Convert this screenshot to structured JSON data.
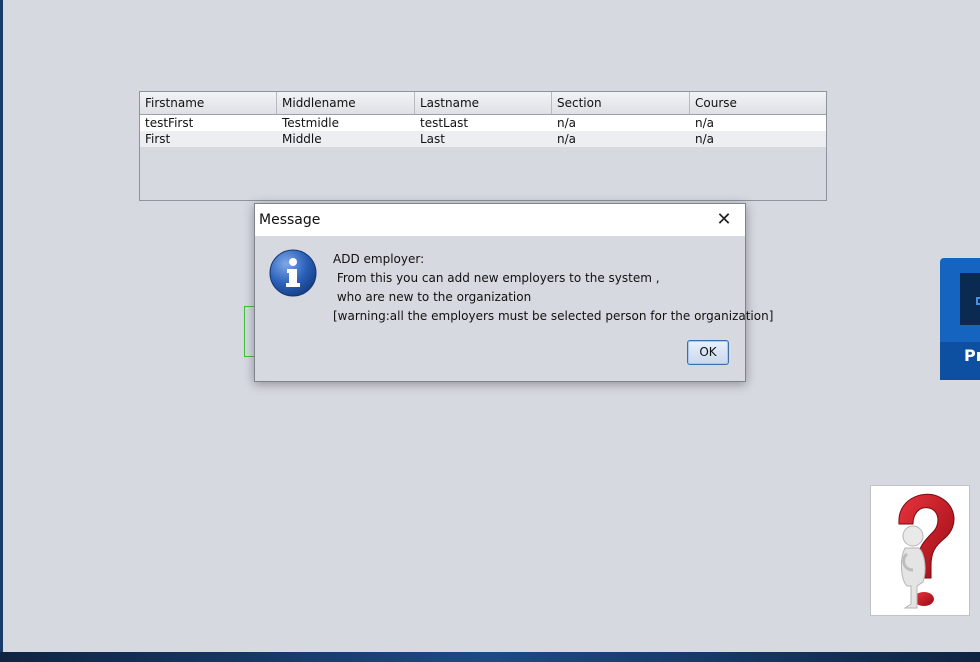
{
  "table": {
    "columns": [
      "Firstname",
      "Middlename",
      "Lastname",
      "Section",
      "Course"
    ],
    "rows": [
      [
        "testFirst",
        "Testmidle",
        "testLast",
        "n/a",
        "n/a"
      ],
      [
        "First",
        "Middle",
        "Last",
        "n/a",
        "n/a"
      ]
    ]
  },
  "side_tile": {
    "label": "Pr"
  },
  "dialog": {
    "title": "Message",
    "close_glyph": "✕",
    "lines": [
      "ADD employer:",
      " From this you can add new employers to the system ,",
      " who are new to the organization",
      "[warning:all the employers must be selected person for the organization]"
    ],
    "ok_label": "OK"
  },
  "colors": {
    "background": "#d6d9e0",
    "dialog_title_bg": "#ffffff",
    "info_icon_blue": "#2a5fb8",
    "help_red": "#c8141e",
    "tile_blue": "#1565c0"
  },
  "icons": [
    "info-icon",
    "close-icon",
    "question-mark-figure-icon"
  ]
}
